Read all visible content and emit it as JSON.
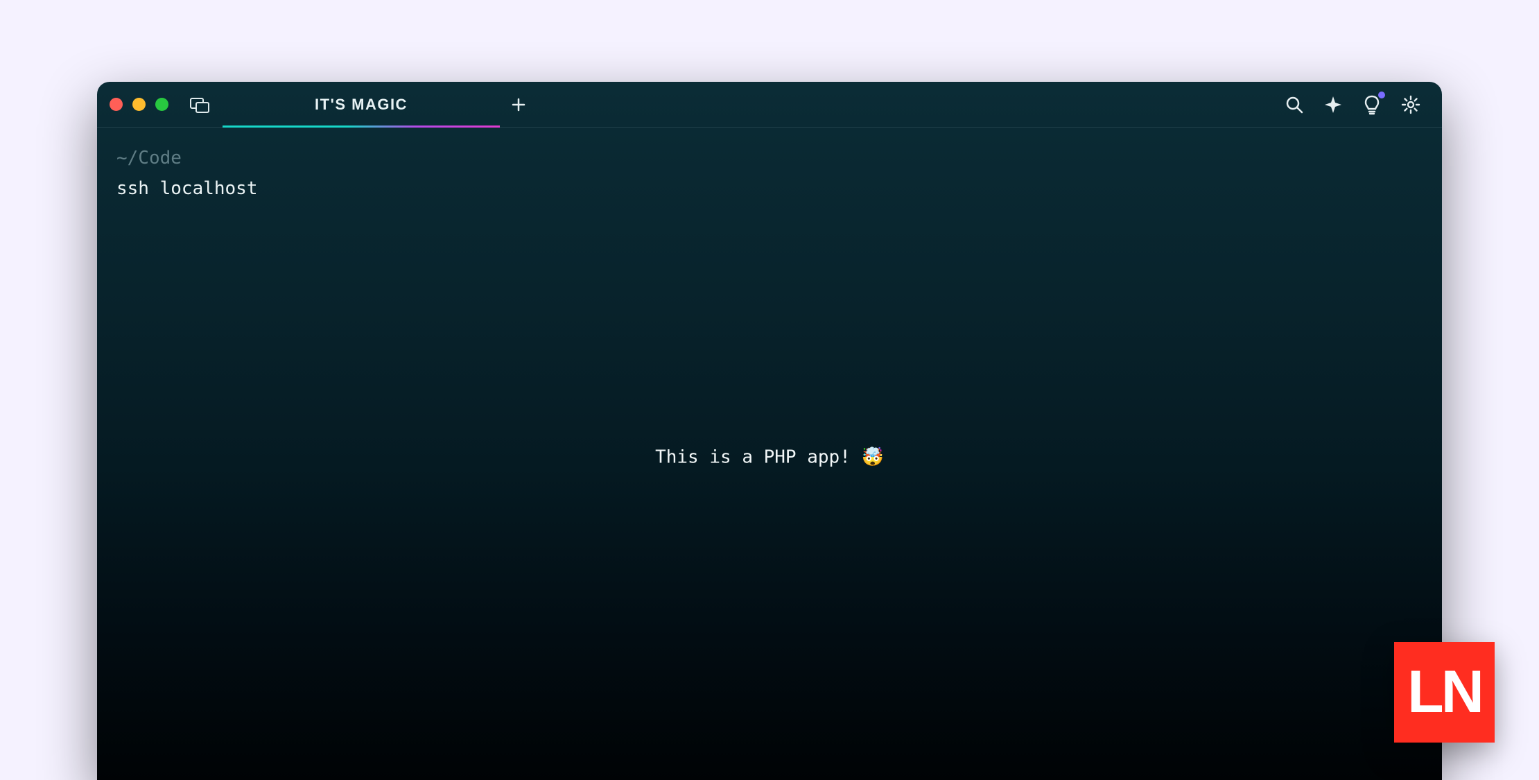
{
  "tab": {
    "title": "IT'S MAGIC"
  },
  "prompt": {
    "path": "~/Code",
    "command": "ssh localhost"
  },
  "center": {
    "message": "This is a PHP app! 🤯"
  },
  "logo": {
    "text": "LN"
  },
  "icons": {
    "panels": "panels-icon",
    "new_tab": "plus-icon",
    "search": "search-icon",
    "sparkle": "sparkle-icon",
    "bulb": "bulb-icon",
    "gear": "gear-icon"
  }
}
